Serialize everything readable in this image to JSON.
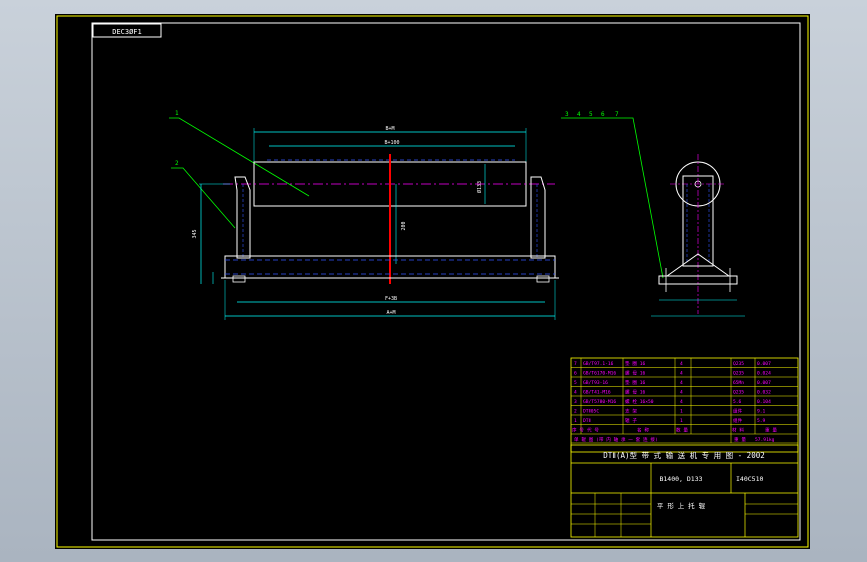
{
  "drawing_code": "DEC3ØF1",
  "main_view": {
    "part_labels": [
      "1",
      "2"
    ],
    "dim_top_outer": "B+M",
    "dim_top_inner": "B+100",
    "dim_diameter": "Ø133",
    "dim_height_center": "200",
    "dim_height_total": "345",
    "dim_bottom_inner": "F+3B",
    "dim_bottom_outer": "A+M"
  },
  "side_view": {
    "part_labels": [
      "3",
      "4",
      "5",
      "6",
      "7"
    ]
  },
  "colors": {
    "background": "#000000",
    "outline": "#ffffff",
    "leader": "#00ff00",
    "centerline": "#ff00ff",
    "hidden": "#3355ff",
    "dimension": "#00ffff",
    "section": "#ff0000",
    "frame": "#ffff00"
  },
  "parts_list": {
    "rows": [
      {
        "no": "7",
        "spec": "GB/T97.1-16",
        "name": "垫 圈 16",
        "qty": "4",
        "material": "Q235",
        "weight": "0.007"
      },
      {
        "no": "6",
        "spec": "GB/T6170-M16",
        "name": "螺 母 16",
        "qty": "4",
        "material": "Q235",
        "weight": "0.024"
      },
      {
        "no": "5",
        "spec": "GB/T93-16",
        "name": "垫 圈 16",
        "qty": "4",
        "material": "65Mn",
        "weight": "0.007"
      },
      {
        "no": "4",
        "spec": "GB/T41-M16",
        "name": "螺 母 16",
        "qty": "4",
        "material": "Q235",
        "weight": "0.032"
      },
      {
        "no": "3",
        "spec": "GB/T5780-M16",
        "name": "螺 栓 16×50",
        "qty": "4",
        "material": "5.6",
        "weight": "0.104"
      },
      {
        "no": "2",
        "spec": "DTⅡ05C",
        "name": "支 架",
        "qty": "1",
        "material": "组件",
        "weight": "9.1"
      },
      {
        "no": "1",
        "spec": "DTⅡ",
        "name": "辊 子",
        "qty": "1",
        "material": "组件",
        "weight": "5.9"
      }
    ],
    "header": {
      "no": "序 号",
      "spec": "代 号",
      "name": "名 称",
      "qty": "数 量",
      "material": "材 料",
      "weight": "重 量"
    },
    "remark_label": "重 量",
    "remark_value": "57.91kg",
    "note": "单 辊 图   (带 内 轴 承   一 套 连 接)"
  },
  "title_block": {
    "series": "DTⅡ(A)型  带 式 输 送 机 专 用 图 - 2002",
    "spec": "B1400, D133",
    "drawing_no": "I40C510",
    "name": "平 形 上 托 辊"
  }
}
